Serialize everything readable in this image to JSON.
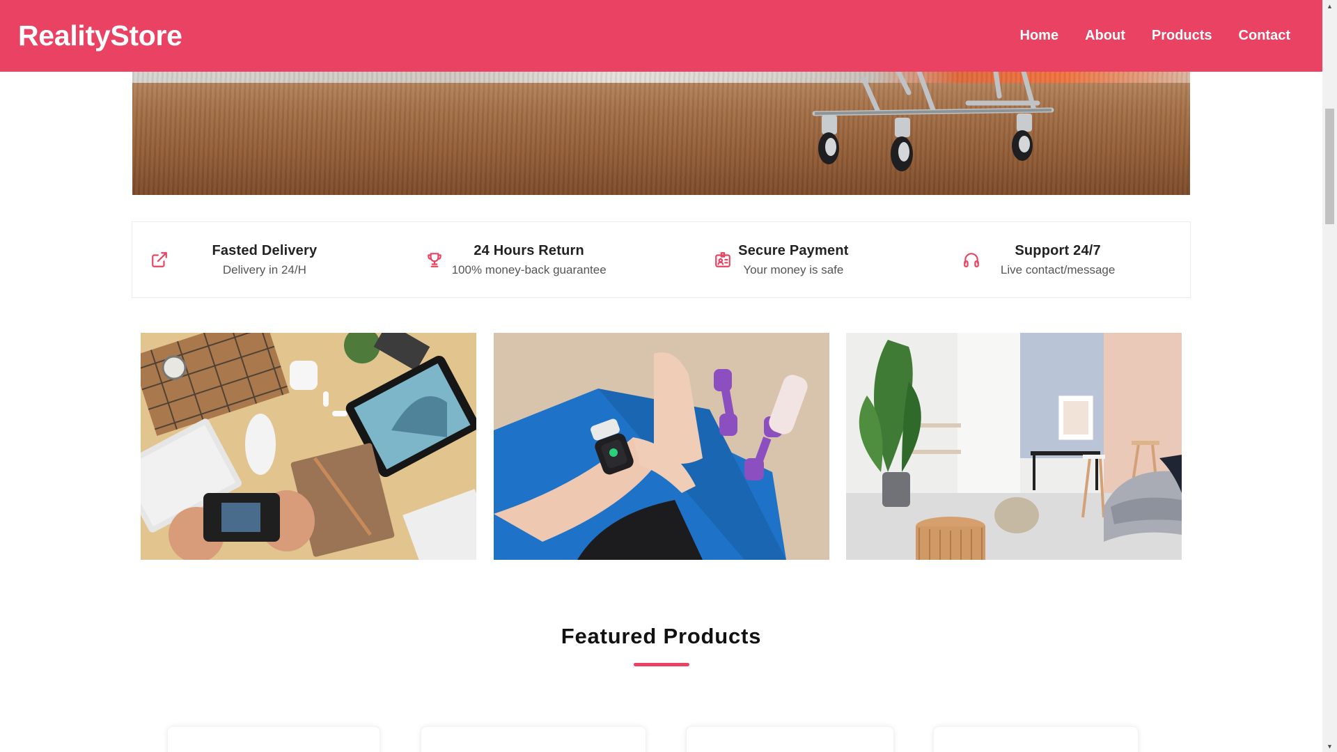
{
  "header": {
    "logo": "RealityStore",
    "nav": [
      {
        "label": "Home"
      },
      {
        "label": "About"
      },
      {
        "label": "Products"
      },
      {
        "label": "Contact"
      }
    ]
  },
  "features": [
    {
      "icon": "external-link-icon",
      "title": "Fasted Delivery",
      "subtitle": "Delivery in 24/H"
    },
    {
      "icon": "trophy-icon",
      "title": "24 Hours Return",
      "subtitle": "100% money-back guarantee"
    },
    {
      "icon": "id-badge-icon",
      "title": "Secure Payment",
      "subtitle": "Your money is safe"
    },
    {
      "icon": "headphones-icon",
      "title": "Support 24/7",
      "subtitle": "Live contact/message"
    }
  ],
  "categories": [
    {
      "name": "gadgets-flatlay"
    },
    {
      "name": "fitness-smartwatch"
    },
    {
      "name": "home-interior"
    }
  ],
  "featured": {
    "title": "Featured Products"
  },
  "colors": {
    "accent": "#e94262",
    "text": "#222222"
  }
}
